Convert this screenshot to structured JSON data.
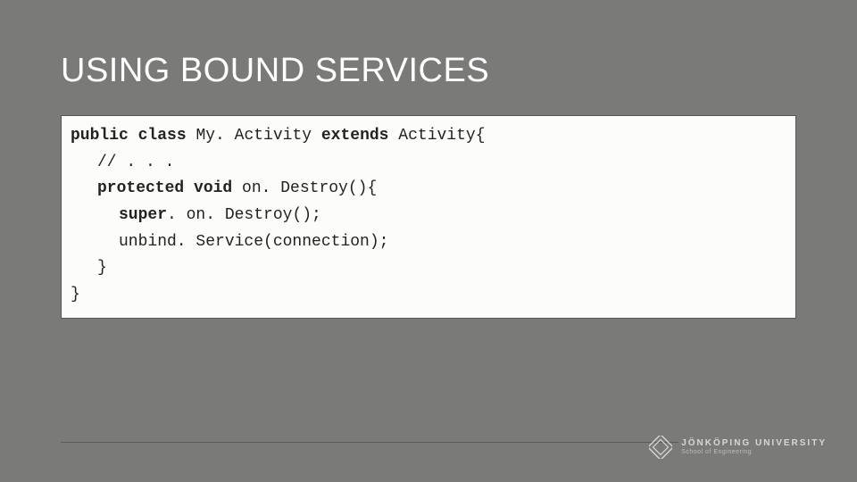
{
  "title": "USING BOUND SERVICES",
  "code": {
    "l1_kw1": "public class ",
    "l1_mid": "My. Activity ",
    "l1_kw2": "extends",
    "l1_end": " Activity{",
    "l2": "// . . .",
    "l3_kw": "protected void",
    "l3_rest": " on. Destroy(){",
    "l4_kw": "super",
    "l4_rest": ". on. Destroy();",
    "l5": "unbind. Service(connection);",
    "l6": "}",
    "l7": "}"
  },
  "logo": {
    "university": "JÖNKÖPING UNIVERSITY",
    "school": "School of Engineering"
  }
}
